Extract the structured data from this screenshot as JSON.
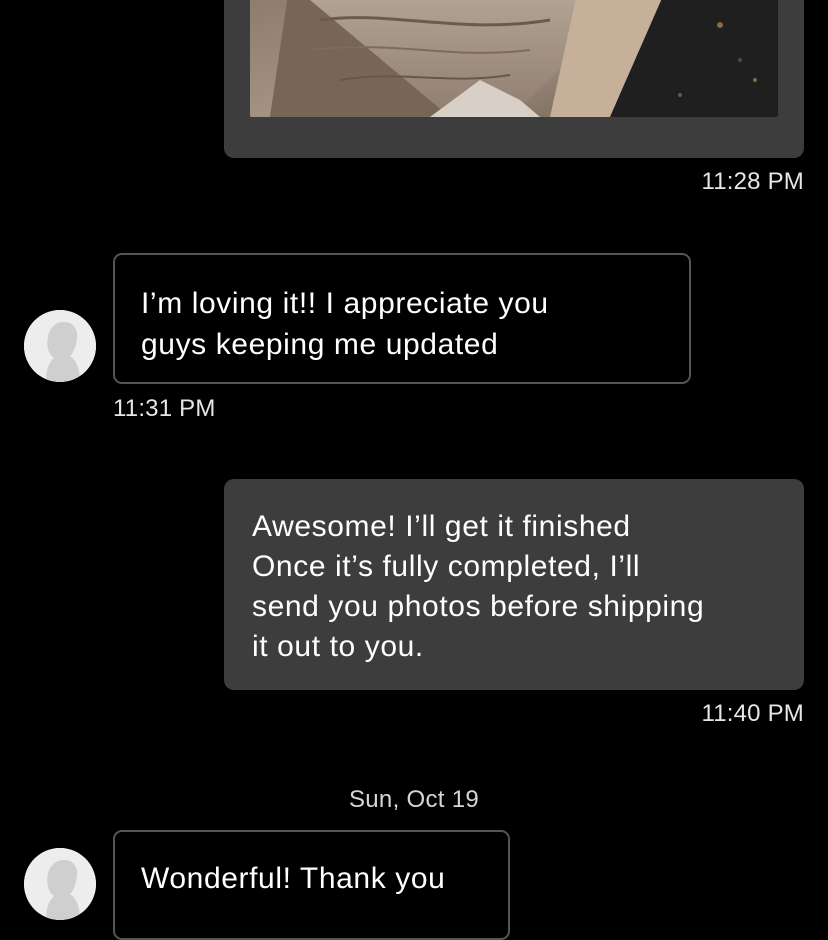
{
  "messages": [
    {
      "direction": "outgoing",
      "type": "photo",
      "image": "wood-craft-photo",
      "time": "11:28 PM"
    },
    {
      "direction": "incoming",
      "type": "text",
      "lines": [
        "I’m loving it!! I appreciate you",
        "guys keeping me updated"
      ],
      "time": "11:31 PM"
    },
    {
      "direction": "outgoing",
      "type": "text",
      "lines": [
        "Awesome! I’ll get it finished",
        "Once it’s fully completed, I’ll",
        "send you photos before shipping",
        "it out to you."
      ],
      "time": "11:40 PM"
    },
    {
      "direction": "incoming",
      "type": "text",
      "lines": [
        "Wonderful! Thank you"
      ]
    }
  ],
  "date_separator": "Sun, Oct 19",
  "colors": {
    "background": "#000000",
    "outgoing_bubble": "#3d3d3d",
    "incoming_border": "#555555",
    "text": "#ffffff",
    "avatar": "#ededed"
  },
  "icons": {
    "avatar": "person-silhouette-icon"
  }
}
